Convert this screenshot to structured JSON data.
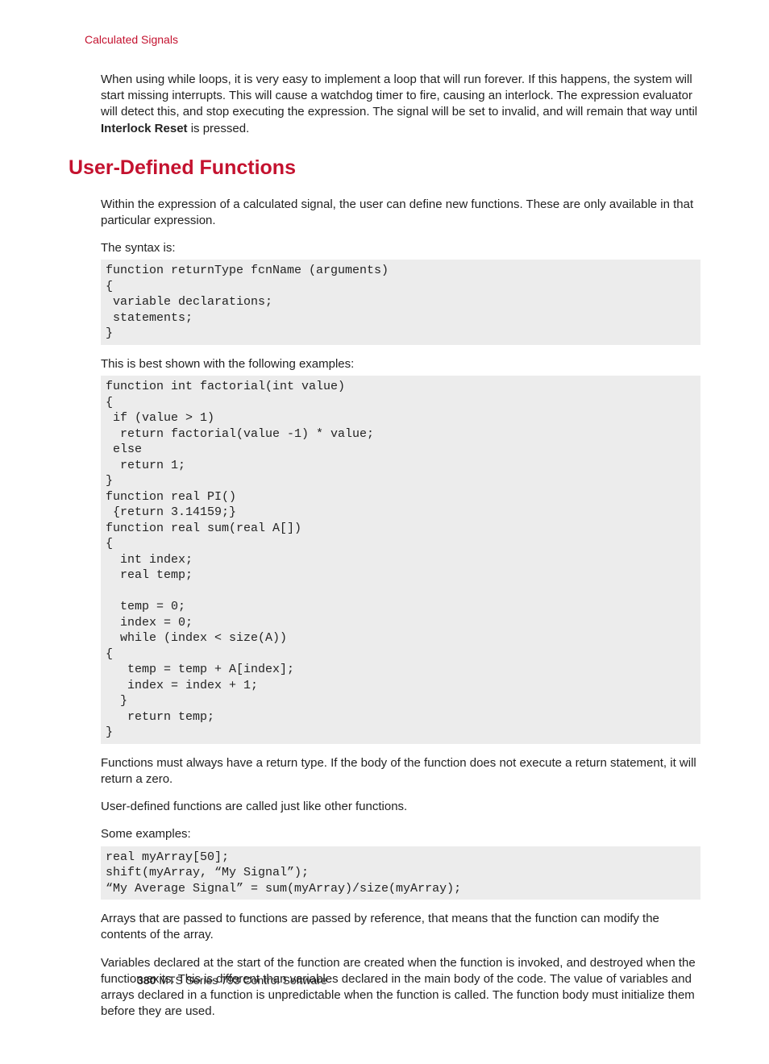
{
  "header": {
    "breadcrumb": "Calculated Signals"
  },
  "intro": {
    "para1_a": "When using while loops, it is very easy to implement a loop that will run forever. If this happens, the system will start missing interrupts. This will cause a watchdog timer to fire, causing an interlock. The expression evaluator will detect this, and stop executing the expression. The signal will be set to invalid, and will remain that way until ",
    "para1_bold": "Interlock Reset",
    "para1_b": " is pressed."
  },
  "section": {
    "title": "User-Defined Functions",
    "p1": "Within the expression of a calculated signal, the user can define new functions. These are only available in that particular expression.",
    "p2": "The syntax is:",
    "code1": "function returnType fcnName (arguments)\n{\n variable declarations;\n statements;\n}",
    "p3": "This is best shown with the following examples:",
    "code2": "function int factorial(int value)\n{\n if (value > 1)\n  return factorial(value -1) * value;\n else\n  return 1;\n}\nfunction real PI()\n {return 3.14159;}\nfunction real sum(real A[])\n{\n  int index;\n  real temp;\n\n  temp = 0;\n  index = 0;\n  while (index < size(A))\n{\n   temp = temp + A[index];\n   index = index + 1;\n  }\n   return temp;\n}",
    "p4": "Functions must always have a return type. If the body of the function does not execute a return statement, it will return a zero.",
    "p5": "User-defined functions are called just like other functions.",
    "p6": "Some examples:",
    "code3": "real myArray[50];\nshift(myArray, “My Signal”);\n“My Average Signal” = sum(myArray)/size(myArray);",
    "p7": "Arrays that are passed to functions are passed by reference, that means that the function can modify the contents of the array.",
    "p8": "Variables declared at the start of the function are created when the function is invoked, and destroyed when the function exits. This is different than variables declared in the main body of the code. The value of variables and arrays declared in a function is unpredictable when the function is called. The function body must initialize them before they are used."
  },
  "footer": {
    "page_number": "380",
    "doc_title": "MTS Series 793 Control Software"
  }
}
